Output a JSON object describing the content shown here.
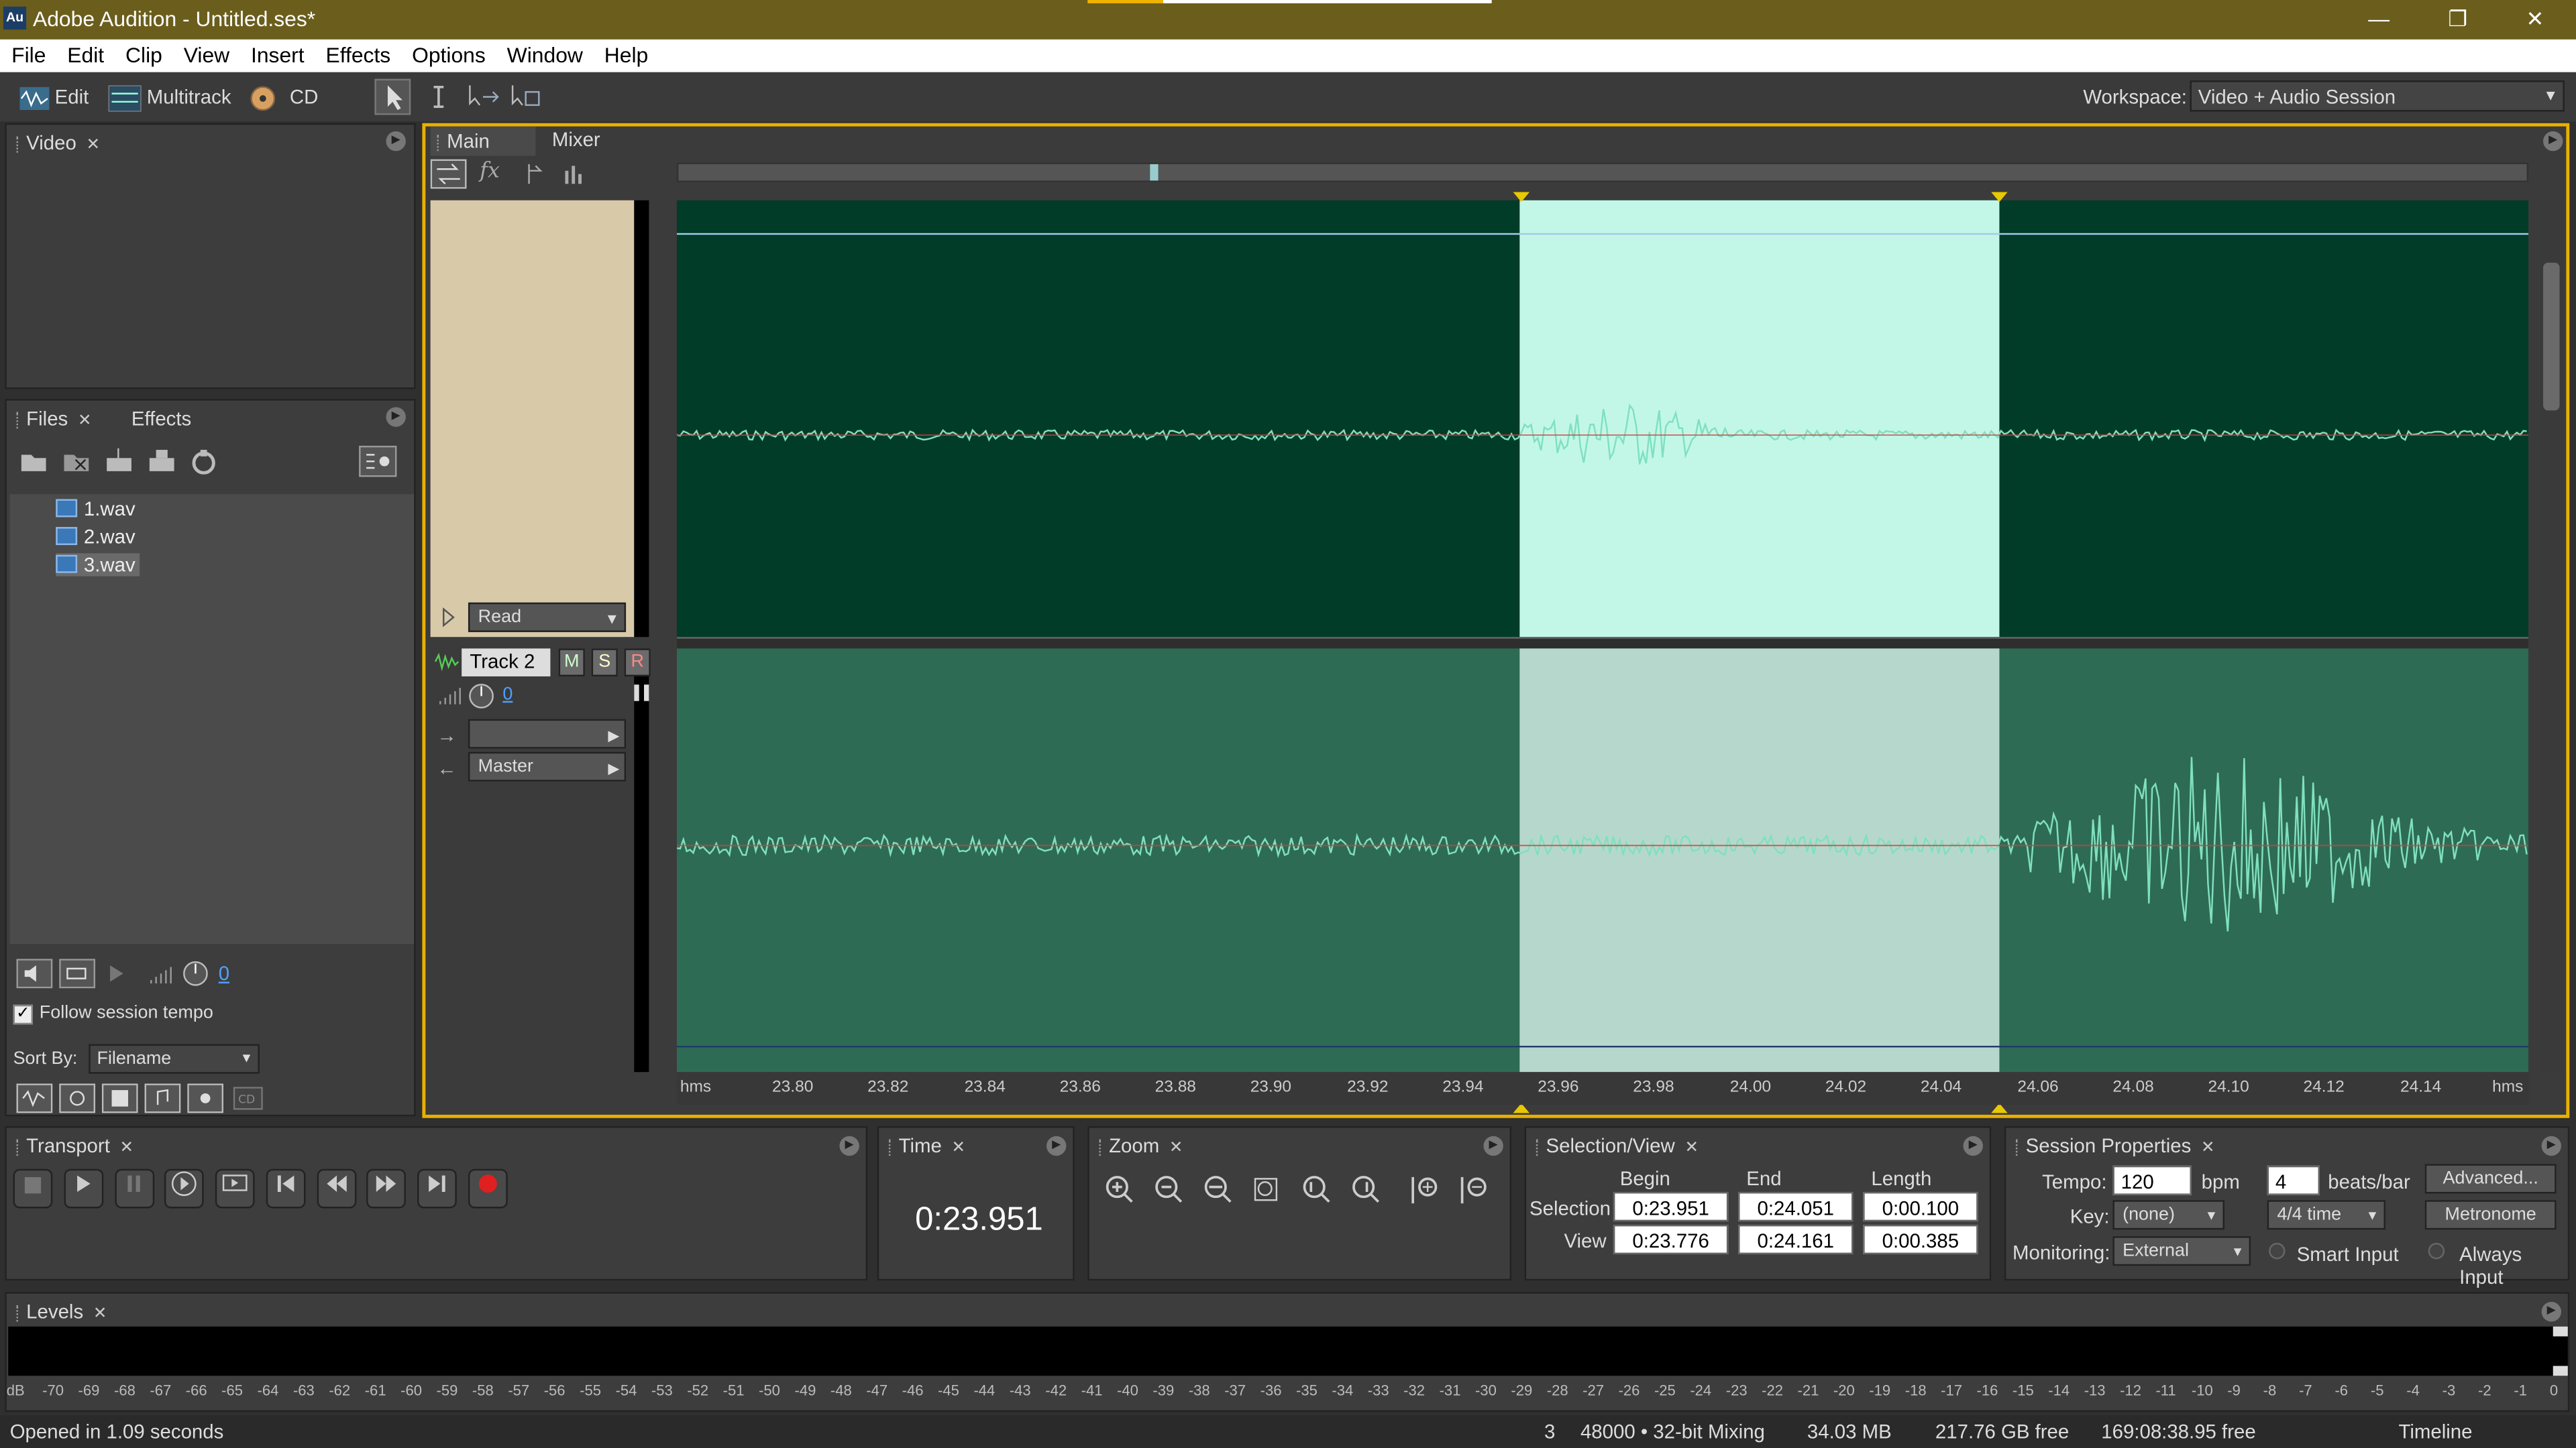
{
  "window": {
    "title": "Adobe Audition - Untitled.ses*",
    "app_icon": "Au",
    "minimize": "—",
    "restore": "❐",
    "close": "✕"
  },
  "menu": [
    "File",
    "Edit",
    "Clip",
    "View",
    "Insert",
    "Effects",
    "Options",
    "Window",
    "Help"
  ],
  "toolbar": {
    "edit": "Edit",
    "multitrack": "Multitrack",
    "cd": "CD",
    "workspace_label": "Workspace:",
    "workspace_value": "Video + Audio Session"
  },
  "video_panel": {
    "tab": "Video"
  },
  "files_panel": {
    "tabs": [
      "Files",
      "Effects"
    ],
    "files": [
      "1.wav",
      "2.wav",
      "3.wav"
    ],
    "volume": "0",
    "follow_tempo": "Follow session tempo",
    "sort_label": "Sort By:",
    "sort_value": "Filename"
  },
  "main": {
    "tabs": [
      "Main",
      "Mixer"
    ]
  },
  "tracks": {
    "read_mode": "Read",
    "track2_name": "Track 2",
    "mute": "M",
    "solo": "S",
    "record": "R",
    "volume": "0",
    "output": "Master"
  },
  "ruler": {
    "unit": "hms",
    "ticks": [
      "23.80",
      "23.82",
      "23.84",
      "23.86",
      "23.88",
      "23.90",
      "23.92",
      "23.94",
      "23.96",
      "23.98",
      "24.00",
      "24.02",
      "24.04",
      "24.06",
      "24.08",
      "24.10",
      "24.12",
      "24.14"
    ]
  },
  "transport": {
    "tab": "Transport"
  },
  "time": {
    "tab": "Time",
    "value": "0:23.951"
  },
  "zoom": {
    "tab": "Zoom"
  },
  "selection_view": {
    "tab": "Selection/View",
    "headers": [
      "Begin",
      "End",
      "Length"
    ],
    "selection_label": "Selection",
    "view_label": "View",
    "selection": [
      "0:23.951",
      "0:24.051",
      "0:00.100"
    ],
    "view": [
      "0:23.776",
      "0:24.161",
      "0:00.385"
    ]
  },
  "session_props": {
    "tab": "Session Properties",
    "tempo_label": "Tempo:",
    "tempo": "120",
    "bpm": "bpm",
    "beats": "4",
    "beats_label": "beats/bar",
    "advanced": "Advanced...",
    "key_label": "Key:",
    "key": "(none)",
    "time_sig": "4/4 time",
    "metronome": "Metronome",
    "monitoring_label": "Monitoring:",
    "monitoring": "External",
    "smart_input": "Smart Input",
    "always_input": "Always Input"
  },
  "levels": {
    "tab": "Levels",
    "scale": [
      "dB",
      "-70",
      "-69",
      "-68",
      "-67",
      "-66",
      "-65",
      "-64",
      "-63",
      "-62",
      "-61",
      "-60",
      "-59",
      "-58",
      "-57",
      "-56",
      "-55",
      "-54",
      "-53",
      "-52",
      "-51",
      "-50",
      "-49",
      "-48",
      "-47",
      "-46",
      "-45",
      "-44",
      "-43",
      "-42",
      "-41",
      "-40",
      "-39",
      "-38",
      "-37",
      "-36",
      "-35",
      "-34",
      "-33",
      "-32",
      "-31",
      "-30",
      "-29",
      "-28",
      "-27",
      "-26",
      "-25",
      "-24",
      "-23",
      "-22",
      "-21",
      "-20",
      "-19",
      "-18",
      "-17",
      "-16",
      "-15",
      "-14",
      "-13",
      "-12",
      "-11",
      "-10",
      "-9",
      "-8",
      "-7",
      "-6",
      "-5",
      "-4",
      "-3",
      "-2",
      "-1",
      "0"
    ]
  },
  "status": {
    "message": "Opened in 1.09 seconds",
    "count": "3",
    "mixing": "48000 • 32-bit Mixing",
    "memory": "34.03 MB",
    "free": "217.76 GB free",
    "duration": "169:08:38.95 free",
    "mode": "Timeline"
  },
  "colors": {
    "title_bar": "#6b5e1d",
    "accent_orange": "#f0b400",
    "track_dark": "#003c28",
    "track_mid": "#2e6b54",
    "selection": "#c2f7e7",
    "waveform": "#7fe0c0"
  }
}
